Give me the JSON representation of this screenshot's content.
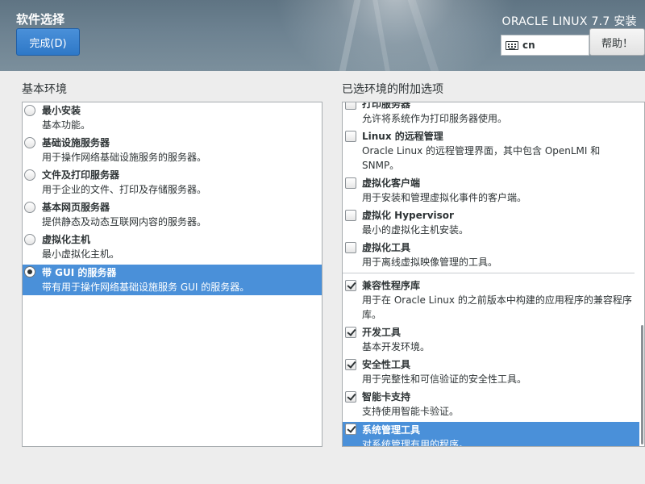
{
  "header": {
    "page_title": "软件选择",
    "done_label": "完成(D)",
    "install_title": "ORACLE LINUX 7.7 安装",
    "keyboard_layout": "cn",
    "help_label": "帮助！"
  },
  "base_env": {
    "heading": "基本环境",
    "items": [
      {
        "name": "最小安装",
        "desc": "基本功能。",
        "selected": false
      },
      {
        "name": "基础设施服务器",
        "desc": "用于操作网络基础设施服务的服务器。",
        "selected": false
      },
      {
        "name": "文件及打印服务器",
        "desc": "用于企业的文件、打印及存储服务器。",
        "selected": false
      },
      {
        "name": "基本网页服务器",
        "desc": "提供静态及动态互联网内容的服务器。",
        "selected": false
      },
      {
        "name": "虚拟化主机",
        "desc": "最小虚拟化主机。",
        "selected": false
      },
      {
        "name": "带 GUI 的服务器",
        "desc": "带有用于操作网络基础设施服务 GUI 的服务器。",
        "selected": true
      }
    ]
  },
  "addons": {
    "heading": "已选环境的附加选项",
    "items": [
      {
        "name": "打印服务器",
        "desc": "允许将系统作为打印服务器使用。",
        "checked": false
      },
      {
        "name": "Linux 的远程管理",
        "desc": "Oracle Linux 的远程管理界面，其中包含 OpenLMI 和 SNMP。",
        "checked": false
      },
      {
        "name": "虚拟化客户端",
        "desc": "用于安装和管理虚拟化事件的客户端。",
        "checked": false
      },
      {
        "name": "虚拟化 Hypervisor",
        "desc": "最小的虚拟化主机安装。",
        "checked": false
      },
      {
        "name": "虚拟化工具",
        "desc": "用于离线虚拟映像管理的工具。",
        "checked": false
      },
      {
        "name": "兼容性程序库",
        "desc": "用于在 Oracle Linux 的之前版本中构建的应用程序的兼容程序库。",
        "checked": true
      },
      {
        "name": "开发工具",
        "desc": "基本开发环境。",
        "checked": true
      },
      {
        "name": "安全性工具",
        "desc": "用于完整性和可信验证的安全性工具。",
        "checked": true
      },
      {
        "name": "智能卡支持",
        "desc": "支持使用智能卡验证。",
        "checked": true
      },
      {
        "name": "系统管理工具",
        "desc": "对系统管理有用的程序。",
        "checked": true
      }
    ]
  },
  "colors": {
    "selection": "#4a90d9",
    "header": "#6d8291",
    "done_button": "#2e78c7"
  }
}
